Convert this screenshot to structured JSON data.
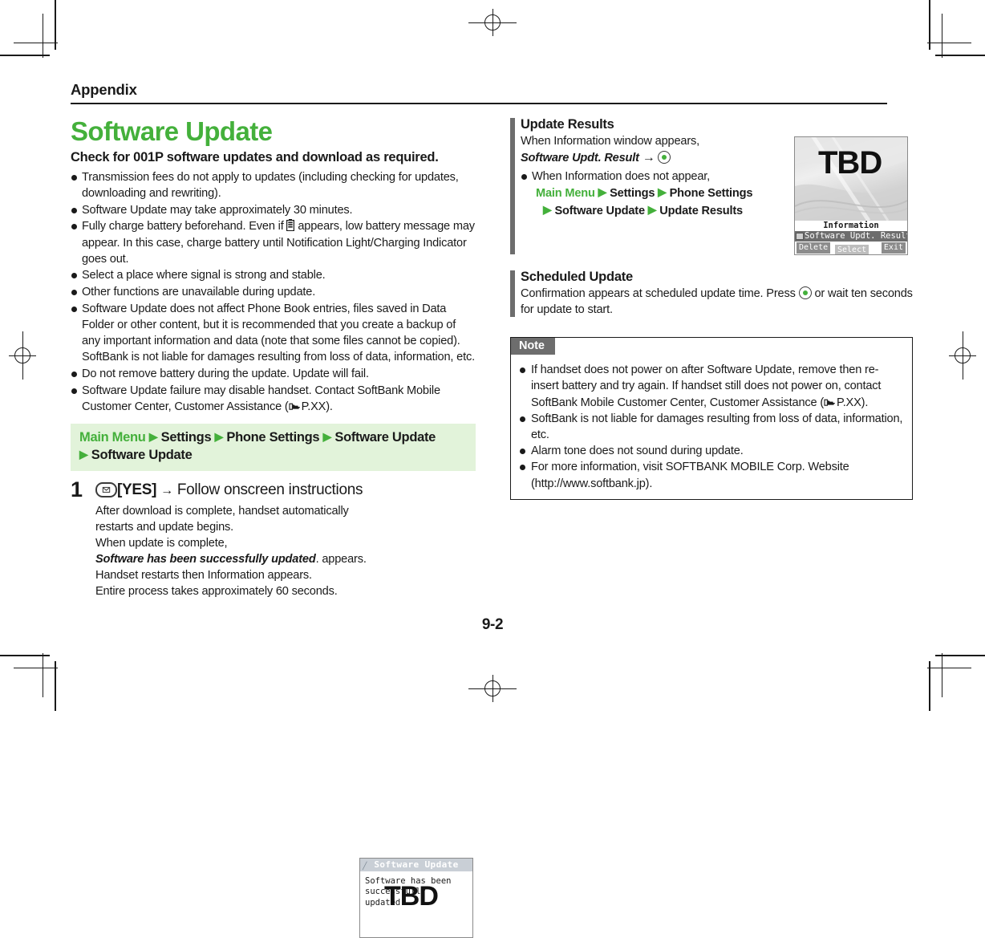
{
  "page": {
    "running_head": "Appendix",
    "folio": "9-2",
    "accent_green": "#44B03B",
    "path_box_bg": "#E2F3DA",
    "bar_gray": "#6d6d6d"
  },
  "left": {
    "title": "Software Update",
    "lede": "Check for 001P software updates and download as required.",
    "bullets": [
      "Transmission fees do not apply to updates (including checking for updates, downloading and rewriting).",
      "Software Update may take approximately 30 minutes.",
      "Software Update does not affect Phone Book entries, files saved in Data Folder or other content, but it is recommended that you create a backup of any important information and data (note that some files cannot be copied). SoftBank is not liable for damages resulting from loss of data, information, etc.",
      "Do not remove battery during the update. Update will fail."
    ],
    "bullet_battery_pre": "Fully charge battery beforehand. Even if",
    "bullet_battery_post": "appears, low battery message may appear. In this case, charge battery until Notification Light/Charging Indicator goes out.",
    "bullet_signal": "Select a place where signal is strong and stable.",
    "bullet_other_functions": "Other functions are unavailable during update.",
    "bullet_failure_pre": "Software Update failure may disable handset. Contact SoftBank Mobile Customer Center, Customer Assistance (",
    "bullet_failure_ref": "P.XX",
    "bullet_failure_post": ").",
    "navpath": {
      "main_menu": "Main Menu",
      "items": [
        "Settings",
        "Phone Settings",
        "Software Update",
        "Software Update"
      ]
    },
    "step": {
      "number": "1",
      "key_icon": "mail-key-icon",
      "head_yes": "[YES]",
      "head_arrow": "→",
      "head_rest": "Follow onscreen instructions",
      "body_line1": "After download is complete, handset automatically restarts and update begins.",
      "body_line2": "When update is complete,",
      "body_emphasis": "Software has been successfully updated",
      "body_line3": ". appears. Handset restarts then Information appears.",
      "body_line4": "Entire process takes approximately 60 seconds."
    },
    "screenshot": {
      "title": "Software Update",
      "line1": "Software has been",
      "line2": "successfully updated.",
      "overlay": "TBD"
    }
  },
  "right": {
    "update_results": {
      "heading": "Update Results",
      "line1": "When Information window appears,",
      "emphasis": "Software Updt. Result",
      "arrow": "→",
      "center_key_icon": "center-key-icon",
      "bullet_lead": "When Information does not appear,",
      "path_main_menu": "Main Menu",
      "path_line1_items": [
        "Settings",
        "Phone Settings"
      ],
      "path_line2_items": [
        "Software Update",
        "Update Results"
      ]
    },
    "scheduled_update": {
      "heading": "Scheduled Update",
      "text_pre": "Confirmation appears at scheduled update time. Press",
      "text_post": "or wait ten seconds for update to start."
    },
    "screenshot": {
      "overlay": "TBD",
      "info_label": "Information",
      "row_label": "Software Updt. Result",
      "softkey_left": "Delete",
      "softkey_center": "Select",
      "softkey_right": "Exit"
    },
    "note": {
      "tab": "Note",
      "items_html": [
        "If handset does not power on after Software Update, remove then re-insert battery and try again. If handset still does not power on, contact SoftBank Mobile Customer Center, Customer Assistance (☞PXX).",
        "SoftBank is not liable for damages resulting from loss of data, information, etc.",
        "Alarm tone does not sound during update.",
        "For more information, visit SOFTBANK MOBILE Corp. Website (http://www.softbank.jp)."
      ],
      "item1_pre": "If handset does not power on after Software Update, remove then re-insert battery and try again. If handset still does not power on, contact SoftBank Mobile Customer Center, Customer Assistance (",
      "item1_ref": "P.XX",
      "item1_post": ").",
      "item2": "SoftBank is not liable for damages resulting from loss of data, information, etc.",
      "item3": "Alarm tone does not sound during update.",
      "item4_line1": "For more information, visit SOFTBANK MOBILE Corp. Website",
      "item4_line2": "(http://www.softbank.jp)."
    }
  }
}
